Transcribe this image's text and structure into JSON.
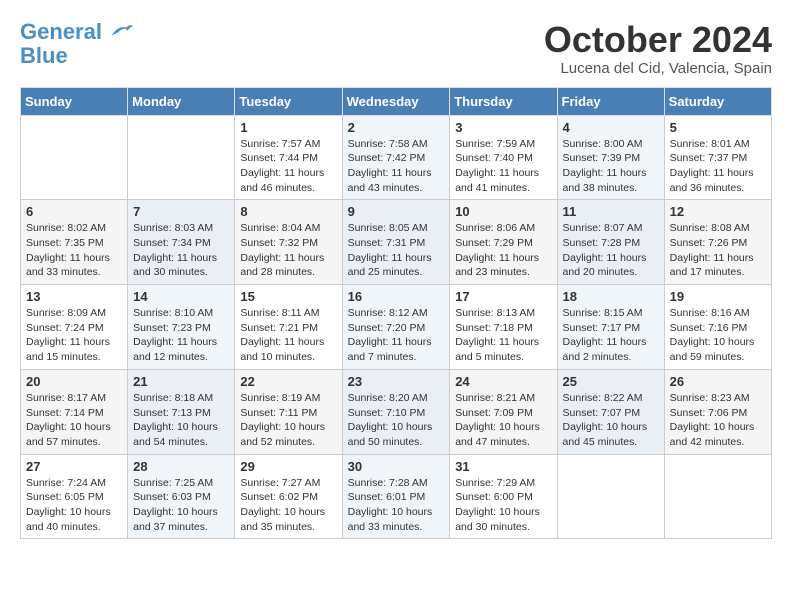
{
  "header": {
    "logo_line1": "General",
    "logo_line2": "Blue",
    "month": "October 2024",
    "location": "Lucena del Cid, Valencia, Spain"
  },
  "days_of_week": [
    "Sunday",
    "Monday",
    "Tuesday",
    "Wednesday",
    "Thursday",
    "Friday",
    "Saturday"
  ],
  "weeks": [
    [
      {
        "day": "",
        "info": ""
      },
      {
        "day": "",
        "info": ""
      },
      {
        "day": "1",
        "info": "Sunrise: 7:57 AM\nSunset: 7:44 PM\nDaylight: 11 hours and 46 minutes."
      },
      {
        "day": "2",
        "info": "Sunrise: 7:58 AM\nSunset: 7:42 PM\nDaylight: 11 hours and 43 minutes."
      },
      {
        "day": "3",
        "info": "Sunrise: 7:59 AM\nSunset: 7:40 PM\nDaylight: 11 hours and 41 minutes."
      },
      {
        "day": "4",
        "info": "Sunrise: 8:00 AM\nSunset: 7:39 PM\nDaylight: 11 hours and 38 minutes."
      },
      {
        "day": "5",
        "info": "Sunrise: 8:01 AM\nSunset: 7:37 PM\nDaylight: 11 hours and 36 minutes."
      }
    ],
    [
      {
        "day": "6",
        "info": "Sunrise: 8:02 AM\nSunset: 7:35 PM\nDaylight: 11 hours and 33 minutes."
      },
      {
        "day": "7",
        "info": "Sunrise: 8:03 AM\nSunset: 7:34 PM\nDaylight: 11 hours and 30 minutes."
      },
      {
        "day": "8",
        "info": "Sunrise: 8:04 AM\nSunset: 7:32 PM\nDaylight: 11 hours and 28 minutes."
      },
      {
        "day": "9",
        "info": "Sunrise: 8:05 AM\nSunset: 7:31 PM\nDaylight: 11 hours and 25 minutes."
      },
      {
        "day": "10",
        "info": "Sunrise: 8:06 AM\nSunset: 7:29 PM\nDaylight: 11 hours and 23 minutes."
      },
      {
        "day": "11",
        "info": "Sunrise: 8:07 AM\nSunset: 7:28 PM\nDaylight: 11 hours and 20 minutes."
      },
      {
        "day": "12",
        "info": "Sunrise: 8:08 AM\nSunset: 7:26 PM\nDaylight: 11 hours and 17 minutes."
      }
    ],
    [
      {
        "day": "13",
        "info": "Sunrise: 8:09 AM\nSunset: 7:24 PM\nDaylight: 11 hours and 15 minutes."
      },
      {
        "day": "14",
        "info": "Sunrise: 8:10 AM\nSunset: 7:23 PM\nDaylight: 11 hours and 12 minutes."
      },
      {
        "day": "15",
        "info": "Sunrise: 8:11 AM\nSunset: 7:21 PM\nDaylight: 11 hours and 10 minutes."
      },
      {
        "day": "16",
        "info": "Sunrise: 8:12 AM\nSunset: 7:20 PM\nDaylight: 11 hours and 7 minutes."
      },
      {
        "day": "17",
        "info": "Sunrise: 8:13 AM\nSunset: 7:18 PM\nDaylight: 11 hours and 5 minutes."
      },
      {
        "day": "18",
        "info": "Sunrise: 8:15 AM\nSunset: 7:17 PM\nDaylight: 11 hours and 2 minutes."
      },
      {
        "day": "19",
        "info": "Sunrise: 8:16 AM\nSunset: 7:16 PM\nDaylight: 10 hours and 59 minutes."
      }
    ],
    [
      {
        "day": "20",
        "info": "Sunrise: 8:17 AM\nSunset: 7:14 PM\nDaylight: 10 hours and 57 minutes."
      },
      {
        "day": "21",
        "info": "Sunrise: 8:18 AM\nSunset: 7:13 PM\nDaylight: 10 hours and 54 minutes."
      },
      {
        "day": "22",
        "info": "Sunrise: 8:19 AM\nSunset: 7:11 PM\nDaylight: 10 hours and 52 minutes."
      },
      {
        "day": "23",
        "info": "Sunrise: 8:20 AM\nSunset: 7:10 PM\nDaylight: 10 hours and 50 minutes."
      },
      {
        "day": "24",
        "info": "Sunrise: 8:21 AM\nSunset: 7:09 PM\nDaylight: 10 hours and 47 minutes."
      },
      {
        "day": "25",
        "info": "Sunrise: 8:22 AM\nSunset: 7:07 PM\nDaylight: 10 hours and 45 minutes."
      },
      {
        "day": "26",
        "info": "Sunrise: 8:23 AM\nSunset: 7:06 PM\nDaylight: 10 hours and 42 minutes."
      }
    ],
    [
      {
        "day": "27",
        "info": "Sunrise: 7:24 AM\nSunset: 6:05 PM\nDaylight: 10 hours and 40 minutes."
      },
      {
        "day": "28",
        "info": "Sunrise: 7:25 AM\nSunset: 6:03 PM\nDaylight: 10 hours and 37 minutes."
      },
      {
        "day": "29",
        "info": "Sunrise: 7:27 AM\nSunset: 6:02 PM\nDaylight: 10 hours and 35 minutes."
      },
      {
        "day": "30",
        "info": "Sunrise: 7:28 AM\nSunset: 6:01 PM\nDaylight: 10 hours and 33 minutes."
      },
      {
        "day": "31",
        "info": "Sunrise: 7:29 AM\nSunset: 6:00 PM\nDaylight: 10 hours and 30 minutes."
      },
      {
        "day": "",
        "info": ""
      },
      {
        "day": "",
        "info": ""
      }
    ]
  ]
}
